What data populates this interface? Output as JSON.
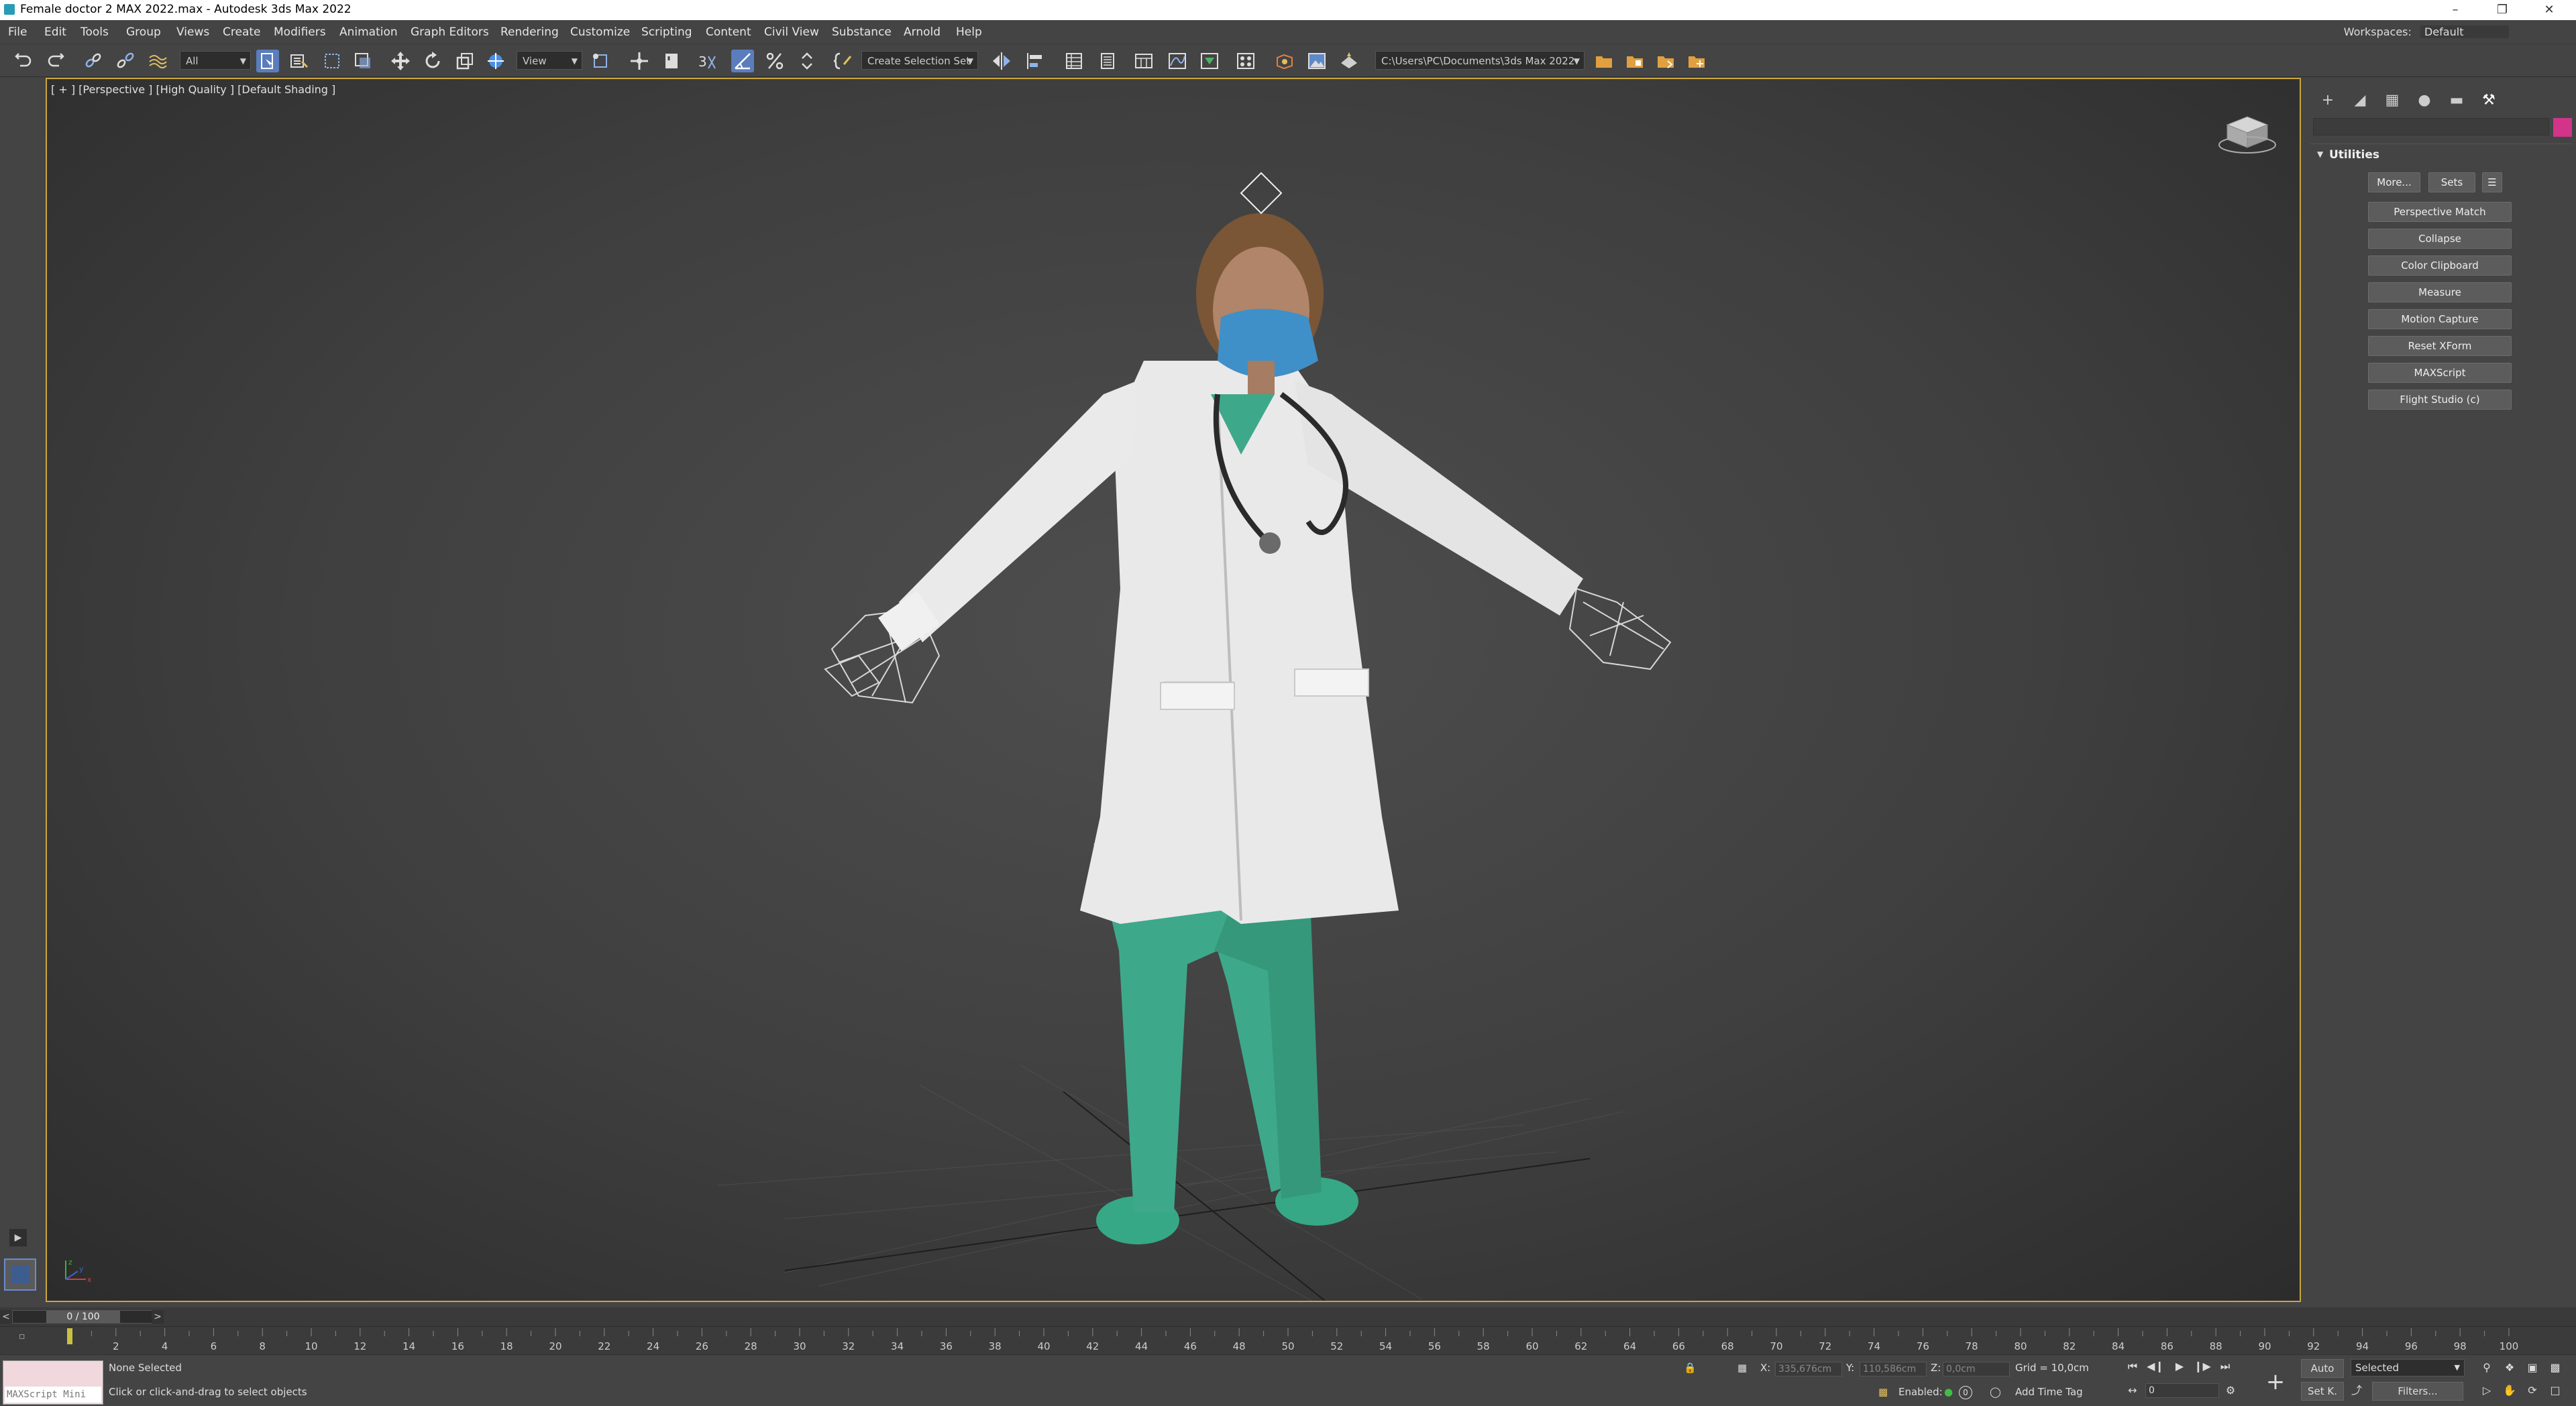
{
  "window": {
    "title": "Female doctor 2 MAX 2022.max - Autodesk 3ds Max 2022",
    "controls": [
      "minimize-icon",
      "restore-icon",
      "close-icon"
    ]
  },
  "menu": {
    "items": [
      "File",
      "Edit",
      "Tools",
      "Group",
      "Views",
      "Create",
      "Modifiers",
      "Animation",
      "Graph Editors",
      "Rendering",
      "Customize",
      "Scripting",
      "Content",
      "Civil View",
      "Substance",
      "Arnold",
      "Help"
    ],
    "workspaces_label": "Workspaces:",
    "workspace_value": "Default"
  },
  "toolbar": {
    "selection_filter": "All",
    "ref_coord": "View",
    "selection_set_placeholder": "Create Selection Set",
    "project_path": "C:\\Users\\PC\\Documents\\3ds Max 2022",
    "snap_label": "3",
    "icons": [
      "undo-icon",
      "redo-icon",
      "link-icon",
      "unlink-icon",
      "bind-spacewarp-icon",
      "select-object-icon",
      "select-by-name-icon",
      "rect-selection-icon",
      "window-crossing-icon",
      "move-icon",
      "rotate-icon",
      "scale-icon",
      "place-icon",
      "pivot-icon",
      "manipulate-icon",
      "keyboard-shortcut-icon",
      "snap-toggle-icon",
      "angle-snap-icon",
      "percent-snap-icon",
      "spinner-snap-icon",
      "edit-named-sets-icon",
      "mirror-icon",
      "align-icon",
      "toggle-scene-explorer-icon",
      "toggle-layer-explorer-icon",
      "toggle-ribbon-icon",
      "curve-editor-icon",
      "schematic-view-icon",
      "material-editor-icon",
      "render-setup-icon",
      "rendered-frame-window-icon",
      "render-production-icon",
      "project-icon"
    ]
  },
  "viewport": {
    "label": "[ + ] [Perspective ] [High Quality ] [Default Shading ]",
    "axis_x": "x",
    "axis_y": "y",
    "axis_z": "z"
  },
  "command_panel": {
    "tabs": [
      "create-tab-icon",
      "modify-tab-icon",
      "hierarchy-tab-icon",
      "motion-tab-icon",
      "display-tab-icon",
      "utilities-tab-icon"
    ],
    "active_tab": "utilities",
    "swatch_color": "#d2348a",
    "rollout_title": "Utilities",
    "more_label": "More...",
    "sets_label": "Sets",
    "buttons": [
      "Perspective Match",
      "Collapse",
      "Color Clipboard",
      "Measure",
      "Motion Capture",
      "Reset XForm",
      "MAXScript",
      "Flight Studio (c)"
    ]
  },
  "timeline": {
    "frame_display": "0 / 100",
    "ticks": [
      "2",
      "4",
      "6",
      "8",
      "10",
      "12",
      "14",
      "16",
      "18",
      "20",
      "22",
      "24",
      "26",
      "28",
      "30",
      "32",
      "34",
      "36",
      "38",
      "40",
      "42",
      "44",
      "46",
      "48",
      "50",
      "52",
      "54",
      "56",
      "58",
      "60",
      "62",
      "64",
      "66",
      "68",
      "70",
      "72",
      "74",
      "76",
      "78",
      "80",
      "82",
      "84",
      "86",
      "88",
      "90",
      "92",
      "94",
      "96",
      "98",
      "100"
    ],
    "current_frame": 0,
    "total_frames": 100
  },
  "status": {
    "maxscript_label": "MAXScript Mini",
    "selection": "None Selected",
    "prompt": "Click or click-and-drag to select objects",
    "x_label": "X:",
    "x_value": "335,676cm",
    "y_label": "Y:",
    "y_value": "110,586cm",
    "z_label": "Z:",
    "z_value": "0,0cm",
    "grid": "Grid = 10,0cm",
    "enabled_label": "Enabled:",
    "enabled_value": "0",
    "add_time_tag": "Add Time Tag",
    "auto_label": "Auto",
    "setkey_label": "Set K.",
    "key_filter": "Selected",
    "filters_label": "Filters...",
    "frame_field": "0"
  }
}
